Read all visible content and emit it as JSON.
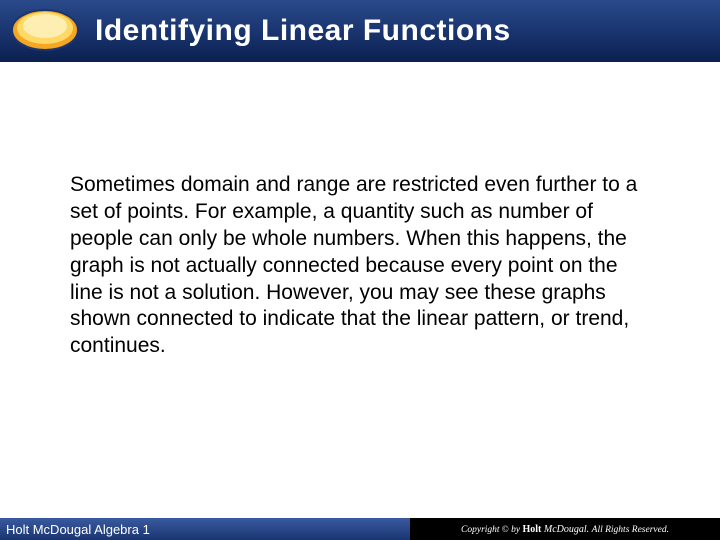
{
  "header": {
    "title": "Identifying Linear Functions"
  },
  "content": {
    "paragraph": "Sometimes domain and range are restricted even further to a set of points. For example, a quantity such as number of people can only be whole numbers. When this happens, the graph is not actually connected because every point on the line is not a solution. However, you may see these graphs shown connected to indicate that the linear pattern, or trend, continues."
  },
  "footer": {
    "left_text": "Holt McDougal Algebra 1",
    "copyright_prefix": "Copyright",
    "copyright_by": "by",
    "publisher_holt": "Holt",
    "publisher_mcdougal": "McDougal.",
    "rights": "All Rights Reserved."
  }
}
